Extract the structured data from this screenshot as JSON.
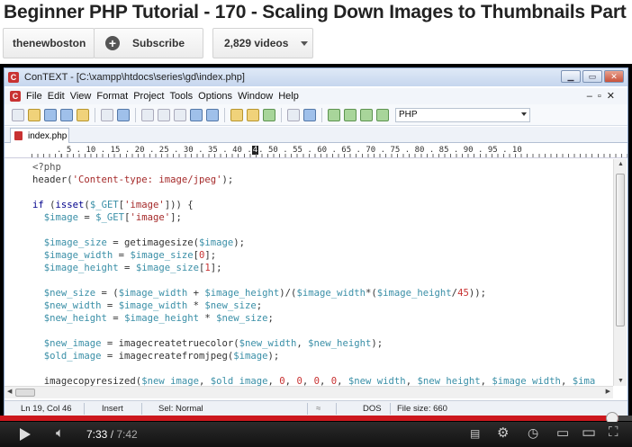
{
  "video": {
    "title": "Beginner PHP Tutorial - 170 - Scaling Down Images to Thumbnails Part",
    "channel": "thenewboston",
    "subscribe": "Subscribe",
    "video_count": "2,829 videos",
    "current_time": "7:33",
    "time_sep": " / ",
    "duration": "7:42",
    "progress": 0.979
  },
  "ide": {
    "window_title": "ConTEXT - [C:\\xampp\\htdocs\\series\\gd\\index.php]",
    "app_icon": "C",
    "menu": [
      "File",
      "Edit",
      "View",
      "Format",
      "Project",
      "Tools",
      "Options",
      "Window",
      "Help"
    ],
    "language": "PHP",
    "tab": "index.php",
    "ruler": [
      ". 5 . 10 . 15 . 20 . 25 . 30 . 35 . 40 .",
      "4",
      ". 50 . 55 . 60 . 65 . 70 . 75 . 80 . 85 . 90 . 95 . 10"
    ],
    "status": {
      "position": "Ln 19, Col 46",
      "mode": "Insert",
      "sel": "Sel: Normal",
      "eol": "DOS",
      "filesize": "File size: 660"
    }
  },
  "code": [
    [
      [
        "pl",
        "<?php"
      ]
    ],
    [
      [
        "fn",
        "header("
      ],
      [
        "str",
        "'Content-type: image/jpeg'"
      ],
      [
        "fn",
        ");"
      ]
    ],
    [],
    [
      [
        "kw",
        "if"
      ],
      [
        "fn",
        " ("
      ],
      [
        "kw",
        "isset"
      ],
      [
        "fn",
        "("
      ],
      [
        "var",
        "$_GET"
      ],
      [
        "fn",
        "["
      ],
      [
        "str",
        "'image'"
      ],
      [
        "fn",
        "])) {"
      ]
    ],
    [
      [
        "var",
        "  $image"
      ],
      [
        "fn",
        " = "
      ],
      [
        "var",
        "$_GET"
      ],
      [
        "fn",
        "["
      ],
      [
        "str",
        "'image'"
      ],
      [
        "fn",
        "];"
      ]
    ],
    [],
    [
      [
        "var",
        "  $image_size"
      ],
      [
        "fn",
        " = getimagesize("
      ],
      [
        "var",
        "$image"
      ],
      [
        "fn",
        ");"
      ]
    ],
    [
      [
        "var",
        "  $image_width"
      ],
      [
        "fn",
        " = "
      ],
      [
        "var",
        "$image_size"
      ],
      [
        "fn",
        "["
      ],
      [
        "num",
        "0"
      ],
      [
        "fn",
        "];"
      ]
    ],
    [
      [
        "var",
        "  $image_height"
      ],
      [
        "fn",
        " = "
      ],
      [
        "var",
        "$image_size"
      ],
      [
        "fn",
        "["
      ],
      [
        "num",
        "1"
      ],
      [
        "fn",
        "];"
      ]
    ],
    [],
    [
      [
        "var",
        "  $new_size"
      ],
      [
        "fn",
        " = ("
      ],
      [
        "var",
        "$image_width"
      ],
      [
        "fn",
        " + "
      ],
      [
        "var",
        "$image_height"
      ],
      [
        "fn",
        ")/("
      ],
      [
        "var",
        "$image_width"
      ],
      [
        "fn",
        "*("
      ],
      [
        "var",
        "$image_height"
      ],
      [
        "fn",
        "/"
      ],
      [
        "num",
        "45"
      ],
      [
        "fn",
        "));"
      ]
    ],
    [
      [
        "var",
        "  $new_width"
      ],
      [
        "fn",
        " = "
      ],
      [
        "var",
        "$image_width"
      ],
      [
        "fn",
        " * "
      ],
      [
        "var",
        "$new_size"
      ],
      [
        "fn",
        ";"
      ]
    ],
    [
      [
        "var",
        "  $new_height"
      ],
      [
        "fn",
        " = "
      ],
      [
        "var",
        "$image_height"
      ],
      [
        "fn",
        " * "
      ],
      [
        "var",
        "$new_size"
      ],
      [
        "fn",
        ";"
      ]
    ],
    [],
    [
      [
        "var",
        "  $new_image"
      ],
      [
        "fn",
        " = imagecreatetruecolor("
      ],
      [
        "var",
        "$new_width"
      ],
      [
        "fn",
        ", "
      ],
      [
        "var",
        "$new_height"
      ],
      [
        "fn",
        ");"
      ]
    ],
    [
      [
        "var",
        "  $old_image"
      ],
      [
        "fn",
        " = imagecreatefromjpeg("
      ],
      [
        "var",
        "$image"
      ],
      [
        "fn",
        ");"
      ]
    ],
    [],
    [
      [
        "fn",
        "  imagecopyresized("
      ],
      [
        "var",
        "$new_image"
      ],
      [
        "fn",
        ", "
      ],
      [
        "var",
        "$old_image"
      ],
      [
        "fn",
        ", "
      ],
      [
        "num",
        "0"
      ],
      [
        "fn",
        ", "
      ],
      [
        "num",
        "0"
      ],
      [
        "fn",
        ", "
      ],
      [
        "num",
        "0"
      ],
      [
        "fn",
        ", "
      ],
      [
        "num",
        "0"
      ],
      [
        "fn",
        ", "
      ],
      [
        "var",
        "$new_width"
      ],
      [
        "fn",
        ", "
      ],
      [
        "var",
        "$new_height"
      ],
      [
        "fn",
        ", "
      ],
      [
        "var",
        "$image_width"
      ],
      [
        "fn",
        ", "
      ],
      [
        "var",
        "$ima"
      ]
    ]
  ]
}
